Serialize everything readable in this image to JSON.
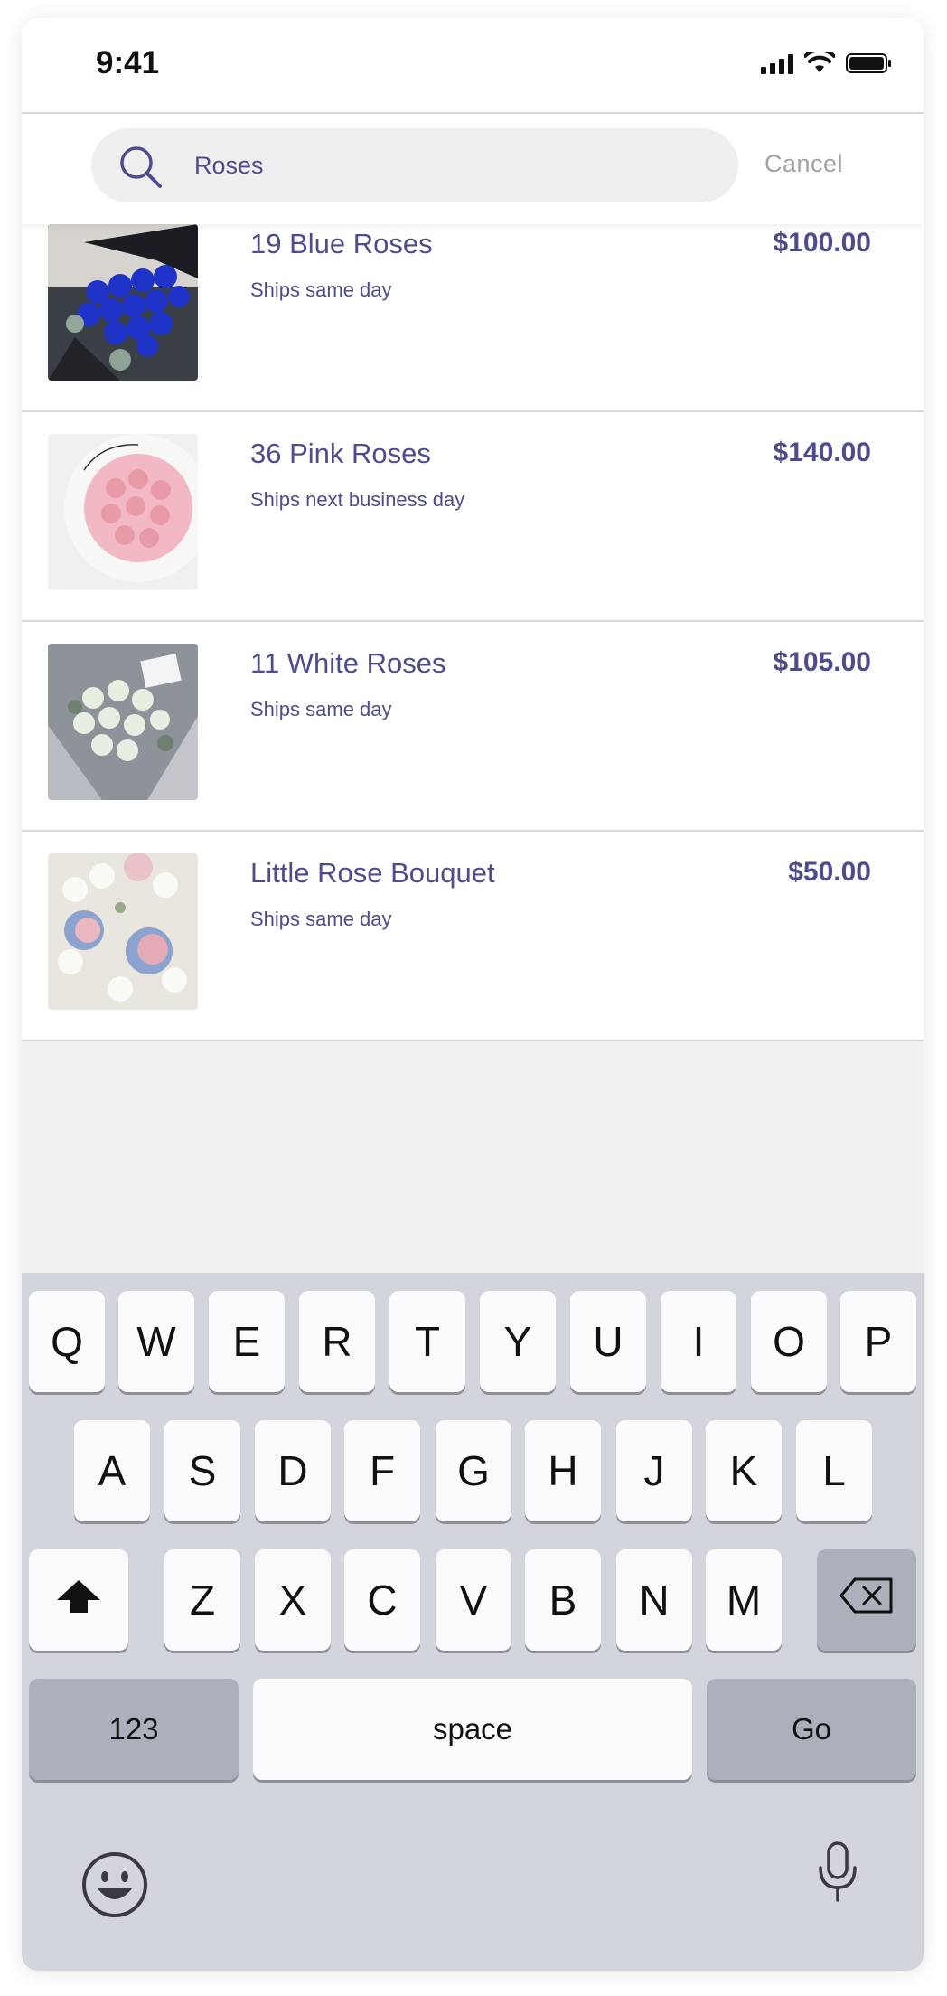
{
  "status_bar": {
    "time": "9:41",
    "signal_icon": "signal-bars-icon",
    "wifi_icon": "wifi-icon",
    "battery_icon": "battery-icon"
  },
  "search": {
    "value": "Roses",
    "placeholder": "",
    "cancel_label": "Cancel",
    "icon": "search-icon"
  },
  "results": [
    {
      "title": "19 Blue Roses",
      "subtitle": "Ships same day",
      "price": "$100.00",
      "image": "blue-roses-bouquet"
    },
    {
      "title": "36 Pink Roses",
      "subtitle": "Ships next business day",
      "price": "$140.00",
      "image": "pink-roses-bouquet"
    },
    {
      "title": "11 White Roses",
      "subtitle": "Ships same day",
      "price": "$105.00",
      "image": "white-roses-bouquet"
    },
    {
      "title": "Little Rose Bouquet",
      "subtitle": "Ships same day",
      "price": "$50.00",
      "image": "little-rose-bouquet"
    }
  ],
  "keyboard": {
    "row1": [
      "Q",
      "W",
      "E",
      "R",
      "T",
      "Y",
      "U",
      "I",
      "O",
      "P"
    ],
    "row2": [
      "A",
      "S",
      "D",
      "F",
      "G",
      "H",
      "J",
      "K",
      "L"
    ],
    "row3": [
      "Z",
      "X",
      "C",
      "V",
      "B",
      "N",
      "M"
    ],
    "shift_icon": "shift-arrow-icon",
    "delete_icon": "delete-backspace-icon",
    "numbers_label": "123",
    "space_label": "space",
    "go_label": "Go",
    "emoji_icon": "emoji-smile-icon",
    "mic_icon": "microphone-icon"
  },
  "colors": {
    "accent": "#4e4c8c",
    "keyboard_bg": "#d2d5dc",
    "key_bg": "#fbfbfd",
    "dark_key_bg": "#abb0ba",
    "empty_bg": "#f1f1f2"
  }
}
